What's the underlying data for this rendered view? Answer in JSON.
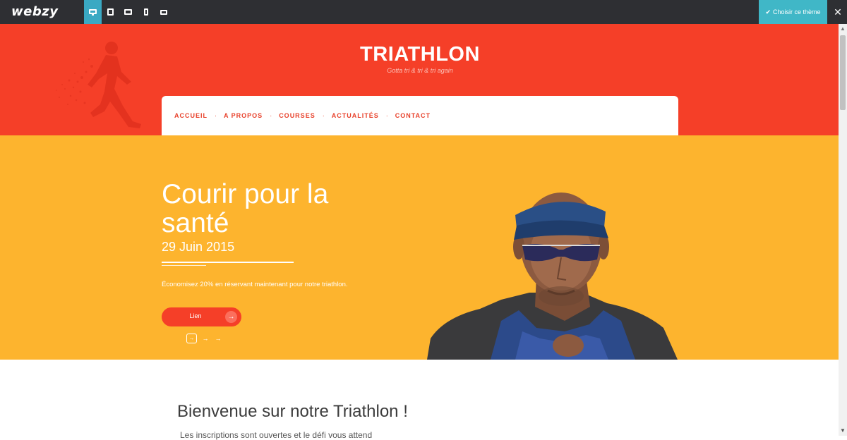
{
  "editor": {
    "brand": "webzy",
    "devices": [
      "desktop-icon",
      "tablet-portrait-icon",
      "tablet-landscape-icon",
      "phone-portrait-icon",
      "phone-landscape-icon"
    ],
    "choose_theme": "Choisir ce thème",
    "close": "✕"
  },
  "site": {
    "title": "TRIATHLON",
    "tagline": "Gotta tri & tri & tri again"
  },
  "nav": {
    "items": [
      {
        "label": "ACCUEIL"
      },
      {
        "label": "A PROPOS"
      },
      {
        "label": "COURSES"
      },
      {
        "label": "ACTUALITÉS"
      },
      {
        "label": "CONTACT"
      }
    ],
    "separator": "·"
  },
  "hero": {
    "title": "Courir pour la santé",
    "date": "29 Juin 2015",
    "text": "Économisez 20% en réservant maintenant pour notre triathlon.",
    "button_label": "Lien",
    "button_arrow": "→",
    "arrows": [
      "→",
      "→",
      "→"
    ]
  },
  "content": {
    "welcome": "Bienvenue sur notre Triathlon !",
    "welcome_sub": "Les inscriptions sont ouvertes et le défi vous attend"
  },
  "colors": {
    "header": "#f53f28",
    "hero": "#fdb42e",
    "accent": "#40b7c7",
    "topbar": "#2e2f33"
  }
}
